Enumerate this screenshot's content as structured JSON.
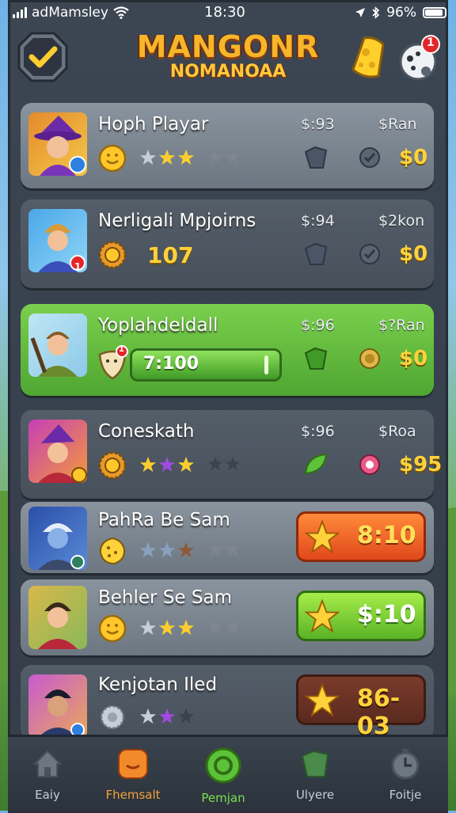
{
  "status_bar": {
    "carrier": "adMamsley",
    "time": "18:30",
    "battery": "96%"
  },
  "header": {
    "title_line1": "MANGONR",
    "title_line2": "NOMANOAA",
    "notification_count": "1"
  },
  "rows": [
    {
      "name": "Hoph Playar",
      "price_a": "$:93",
      "price_b": "$Ran",
      "value": "$0",
      "stars": 3
    },
    {
      "name": "Nerligali Mpjoirns",
      "price_a": "$:94",
      "price_b": "$2kon",
      "value": "$0",
      "level": "107",
      "badge": "1"
    },
    {
      "name": "Yoplahdeldall",
      "price_a": "$:96",
      "price_b": "$?Ran",
      "value": "$0",
      "progress_text": "7:100",
      "badge": "1"
    },
    {
      "name": "Coneskath",
      "price_a": "$:96",
      "price_b": "$Roa",
      "value": "$95",
      "stars": 3
    },
    {
      "name": "PahRa Be Sam",
      "button_value": "8:10",
      "stars": 3
    },
    {
      "name": "Behler Se Sam",
      "button_value": "$:10",
      "stars": 3
    },
    {
      "name": "Kenjotan Iled",
      "button_value": "86-03",
      "stars": 3
    }
  ],
  "nav": [
    {
      "label": "Eaiy",
      "icon": "home-icon"
    },
    {
      "label": "Fhemsalt",
      "icon": "shop-icon"
    },
    {
      "label": "Pemjan",
      "icon": "spin-icon"
    },
    {
      "label": "Ulyere",
      "icon": "map-icon"
    },
    {
      "label": "Foitje",
      "icon": "clock-icon"
    }
  ],
  "colors": {
    "gold": "#ffd23a",
    "green": "#4fa632",
    "orange": "#e1481c",
    "panel": "#3c4653"
  }
}
